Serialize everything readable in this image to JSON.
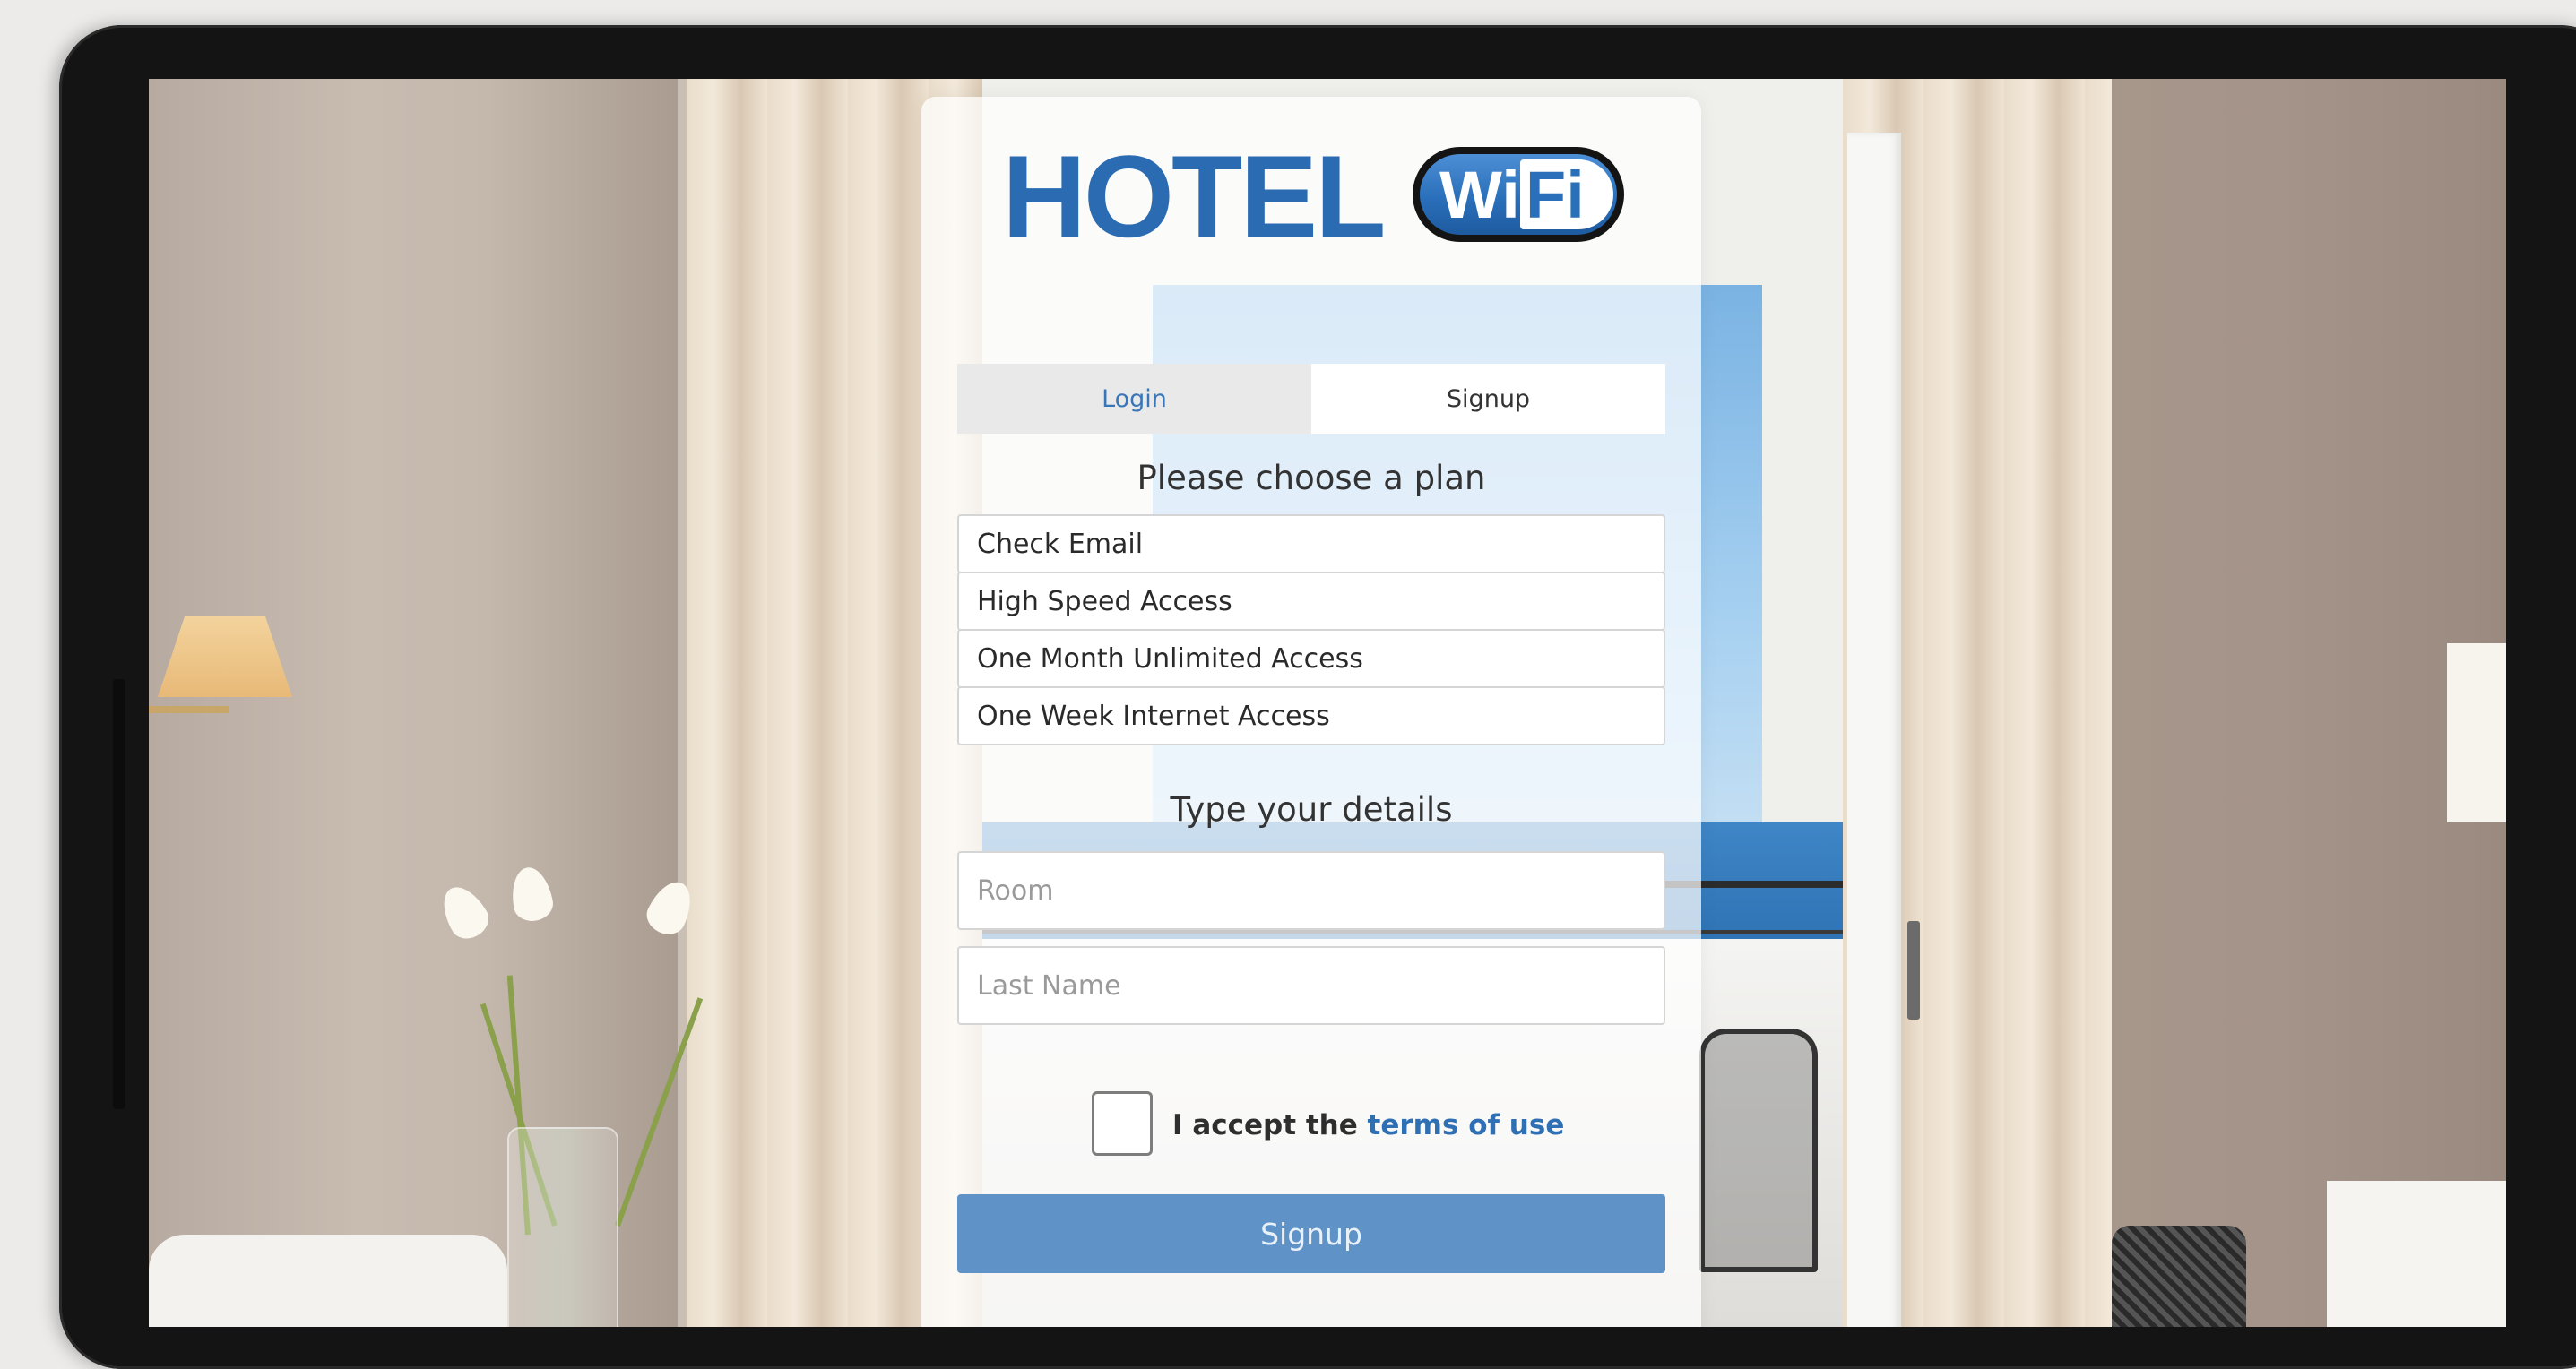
{
  "brand": {
    "hotel_text": "HOTEL",
    "wifi_wi": "Wi",
    "wifi_fi": "Fi",
    "brand_color": "#2b6bb2"
  },
  "tabs": [
    {
      "label": "Login",
      "active": false
    },
    {
      "label": "Signup",
      "active": true
    }
  ],
  "plan_section": {
    "heading": "Please choose a plan",
    "plans": [
      "Check Email",
      "High Speed Access",
      "One Month Unlimited Access",
      "One Week Internet Access"
    ]
  },
  "details_section": {
    "heading": "Type your details",
    "room_placeholder": "Room",
    "last_name_placeholder": "Last Name"
  },
  "terms": {
    "prefix": "I accept the",
    "link": "terms of use",
    "checked": false
  },
  "submit_label": "Signup",
  "colors": {
    "accent": "#2f6fb3",
    "button": "#5f93c8"
  }
}
